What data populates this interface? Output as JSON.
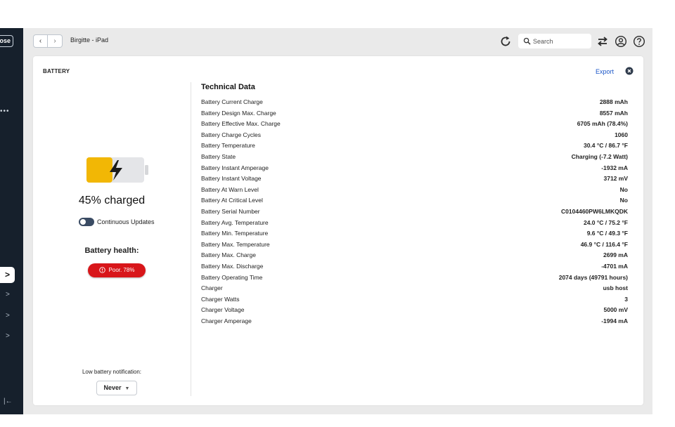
{
  "sidebar": {
    "close_label": "Close",
    "dots": "•••",
    "active_chevron": ">",
    "chevrons": [
      ">",
      ">",
      ">"
    ],
    "collapse": "|←"
  },
  "topbar": {
    "back": "‹",
    "forward": "›",
    "device_title": "Birgitte - iPad",
    "search_placeholder": "Search"
  },
  "panel": {
    "title": "BATTERY",
    "export_label": "Export",
    "accent_color": "#1a56c8"
  },
  "battery": {
    "charge_fraction": 0.45,
    "charge_label": "45% charged",
    "fill_color": "#f2b705",
    "toggle_label": "Continuous Updates",
    "health_label": "Battery health:",
    "health_badge": "Poor. 78%",
    "health_color": "#d8161a",
    "notification_label": "Low battery notification:",
    "notification_value": "Never"
  },
  "technical": {
    "title": "Technical Data",
    "rows": [
      {
        "key": "Battery Current Charge",
        "value": "2888 mAh"
      },
      {
        "key": "Battery Design Max. Charge",
        "value": "8557 mAh"
      },
      {
        "key": "Battery Effective Max. Charge",
        "value": "6705 mAh (78.4%)"
      },
      {
        "key": "Battery Charge Cycles",
        "value": "1060"
      },
      {
        "key": "Battery Temperature",
        "value": "30.4 °C / 86.7 °F"
      },
      {
        "key": "Battery State",
        "value": "Charging (-7.2 Watt)"
      },
      {
        "key": "Battery Instant Amperage",
        "value": "-1932 mA"
      },
      {
        "key": "Battery Instant Voltage",
        "value": "3712 mV"
      },
      {
        "key": "Battery At Warn Level",
        "value": "No"
      },
      {
        "key": "Battery At Critical Level",
        "value": "No"
      },
      {
        "key": "Battery Serial Number",
        "value": "C0104460PW6LMKQDK"
      },
      {
        "key": "Battery Avg. Temperature",
        "value": "24.0 °C / 75.2 °F"
      },
      {
        "key": "Battery Min. Temperature",
        "value": "9.6 °C / 49.3 °F"
      },
      {
        "key": "Battery Max. Temperature",
        "value": "46.9 °C / 116.4 °F"
      },
      {
        "key": "Battery Max. Charge",
        "value": "2699 mA"
      },
      {
        "key": "Battery Max. Discharge",
        "value": "-4701 mA"
      },
      {
        "key": "Battery Operating Time",
        "value": "2074 days (49791 hours)"
      },
      {
        "key": "Charger",
        "value": "usb host"
      },
      {
        "key": "Charger Watts",
        "value": "3"
      },
      {
        "key": "Charger Voltage",
        "value": "5000 mV"
      },
      {
        "key": "Charger Amperage",
        "value": "-1994 mA"
      }
    ]
  }
}
